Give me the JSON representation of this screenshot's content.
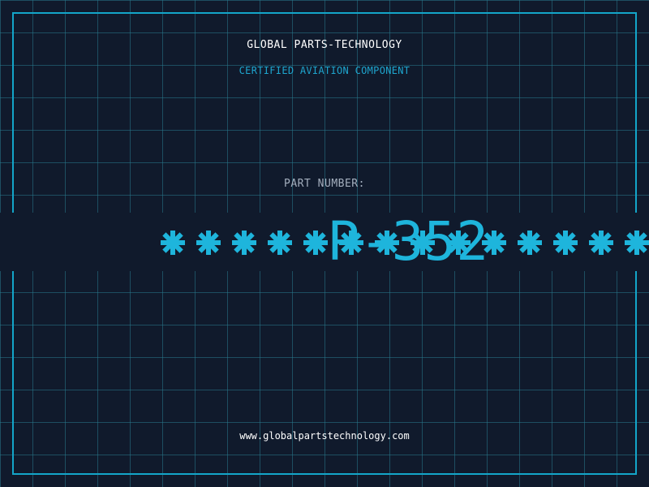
{
  "header": {
    "company": "GLOBAL PARTS-TECHNOLOGY",
    "tagline": "CERTIFIED AVIATION COMPONENT"
  },
  "part": {
    "label": "PART NUMBER:",
    "number_visible": "P-352",
    "masked_char_count": 14
  },
  "footer": {
    "url": "www.globalpartstechnology.com"
  },
  "colors": {
    "background": "#101a2c",
    "grid": "#28788c",
    "accent": "#1eb5dc",
    "frame": "#13a5c9",
    "label_gray": "#a4afbe"
  }
}
